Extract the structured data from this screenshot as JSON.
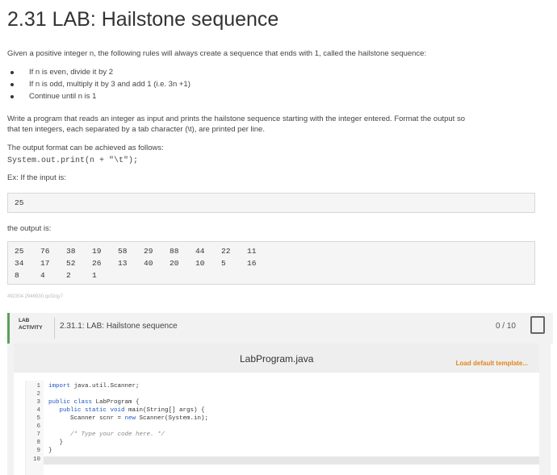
{
  "title": "2.31 LAB: Hailstone sequence",
  "intro": "Given a positive integer n, the following rules will always create a sequence that ends with 1, called the hailstone sequence:",
  "rules": [
    "If n is even, divide it by 2",
    "If n is odd, multiply it by 3 and add 1 (i.e. 3n +1)",
    "Continue until n is 1"
  ],
  "para1_line1": "Write a program that reads an integer as input and prints the hailstone sequence starting with the integer entered. Format the output so",
  "para1_line2": "that ten integers, each separated by a tab character (\\t), are printed per line.",
  "format_text": "The output format can be achieved as follows:",
  "code_snippet": "System.out.print(n + \"\\t\");",
  "example_label": "Ex: If the input is:",
  "input_value": "25",
  "output_label": "the output is:",
  "output_rows": [
    [
      "25",
      "76",
      "38",
      "19",
      "58",
      "29",
      "88",
      "44",
      "22",
      "11"
    ],
    [
      "34",
      "17",
      "52",
      "26",
      "13",
      "40",
      "20",
      "10",
      "5",
      "16"
    ],
    [
      "8",
      "4",
      "2",
      "1"
    ]
  ],
  "tiny_id": "492304.2946930.qx3zqy7",
  "lab": {
    "tag_line1": "LAB",
    "tag_line2": "ACTIVITY",
    "name": "2.31.1: LAB: Hailstone sequence",
    "score": "0 / 10"
  },
  "editor": {
    "filename": "LabProgram.java",
    "load_template": "Load default template...",
    "line_numbers": [
      "1",
      "2",
      "3",
      "4",
      "5",
      "6",
      "7",
      "8",
      "9",
      "10"
    ]
  }
}
